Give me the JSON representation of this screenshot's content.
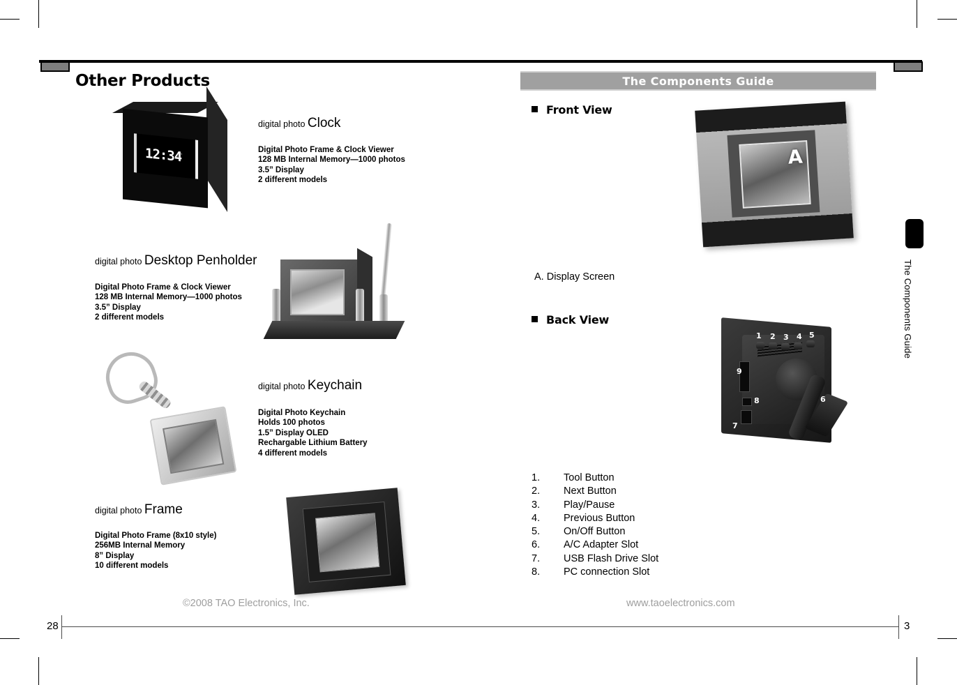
{
  "document": {
    "left_page": {
      "heading": "Other Products",
      "page_number": "28",
      "products": [
        {
          "prefix": "digital photo",
          "name": "Clock",
          "specs": [
            "Digital Photo Frame & Clock Viewer",
            "128 MB Internal Memory—1000 photos",
            "3.5” Display",
            "2 different models"
          ],
          "image_alt": "black-digital-photo-clock",
          "display_text": "12:34"
        },
        {
          "prefix": "digital photo",
          "name": "Desktop Penholder",
          "specs": [
            "Digital Photo Frame & Clock Viewer",
            "128 MB Internal Memory—1000 photos",
            "3.5” Display",
            "2 different models"
          ],
          "image_alt": "desktop-penholder-photo-frame"
        },
        {
          "prefix": "digital photo",
          "name": "Keychain",
          "specs": [
            "Digital Photo Keychain",
            "Holds 100 photos",
            "1.5” Display OLED",
            "Rechargable Lithium Battery",
            "4 different models"
          ],
          "image_alt": "digital-photo-keychain"
        },
        {
          "prefix": "digital photo",
          "name": "Frame",
          "specs": [
            "Digital Photo Frame (8x10 style)",
            "256MB Internal Memory",
            "8” Display",
            "10 different models"
          ],
          "image_alt": "digital-photo-frame-8x10"
        }
      ]
    },
    "right_page": {
      "banner_title": "The Components Guide",
      "page_number": "3",
      "side_tab_label": "The Components Guide",
      "front_view": {
        "heading": "Front View",
        "photo_label": "A",
        "caption": "A.  Display Screen"
      },
      "back_view": {
        "heading": "Back View",
        "callouts": [
          "1",
          "2",
          "3",
          "4",
          "5",
          "6",
          "7",
          "8",
          "9"
        ],
        "legend": [
          {
            "num": "1.",
            "label": "Tool Button"
          },
          {
            "num": "2.",
            "label": "Next Button"
          },
          {
            "num": "3.",
            "label": "Play/Pause"
          },
          {
            "num": "4.",
            "label": "Previous Button"
          },
          {
            "num": "5.",
            "label": "On/Off Button"
          },
          {
            "num": "6.",
            "label": "A/C Adapter Slot"
          },
          {
            "num": "7.",
            "label": "USB Flash Drive Slot"
          },
          {
            "num": "8.",
            "label": "PC connection Slot"
          }
        ]
      }
    },
    "footer": {
      "copyright": "©2008 TAO Electronics, Inc.",
      "website": "www.taoelectronics.com"
    },
    "colors": {
      "banner_gray": "#a0a0a0",
      "footer_text": "#9e9e9e",
      "rule_black": "#000000"
    }
  }
}
